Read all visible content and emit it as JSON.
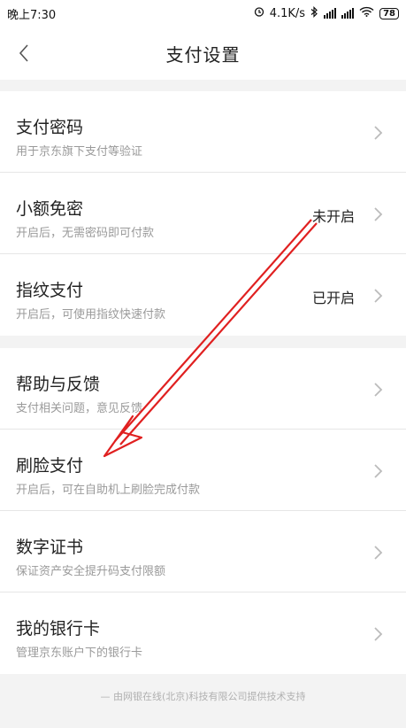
{
  "status_bar": {
    "time": "晚上7:30",
    "net_speed": "4.1K/s",
    "battery": "78"
  },
  "header": {
    "title": "支付设置"
  },
  "group1": [
    {
      "title": "支付密码",
      "subtitle": "用于京东旗下支付等验证",
      "status": ""
    },
    {
      "title": "小额免密",
      "subtitle": "开启后，无需密码即可付款",
      "status": "未开启"
    },
    {
      "title": "指纹支付",
      "subtitle": "开启后，可使用指纹快速付款",
      "status": "已开启"
    }
  ],
  "group2": [
    {
      "title": "帮助与反馈",
      "subtitle": "支付相关问题，意见反馈",
      "status": ""
    },
    {
      "title": "刷脸支付",
      "subtitle": "开启后，可在自助机上刷脸完成付款",
      "status": ""
    },
    {
      "title": "数字证书",
      "subtitle": "保证资产安全提升码支付限额",
      "status": ""
    },
    {
      "title": "我的银行卡",
      "subtitle": "管理京东账户下的银行卡",
      "status": ""
    }
  ],
  "footer": {
    "text": "— 由网银在线(北京)科技有限公司提供技术支持"
  },
  "colors": {
    "annotation_arrow": "#e02020"
  }
}
